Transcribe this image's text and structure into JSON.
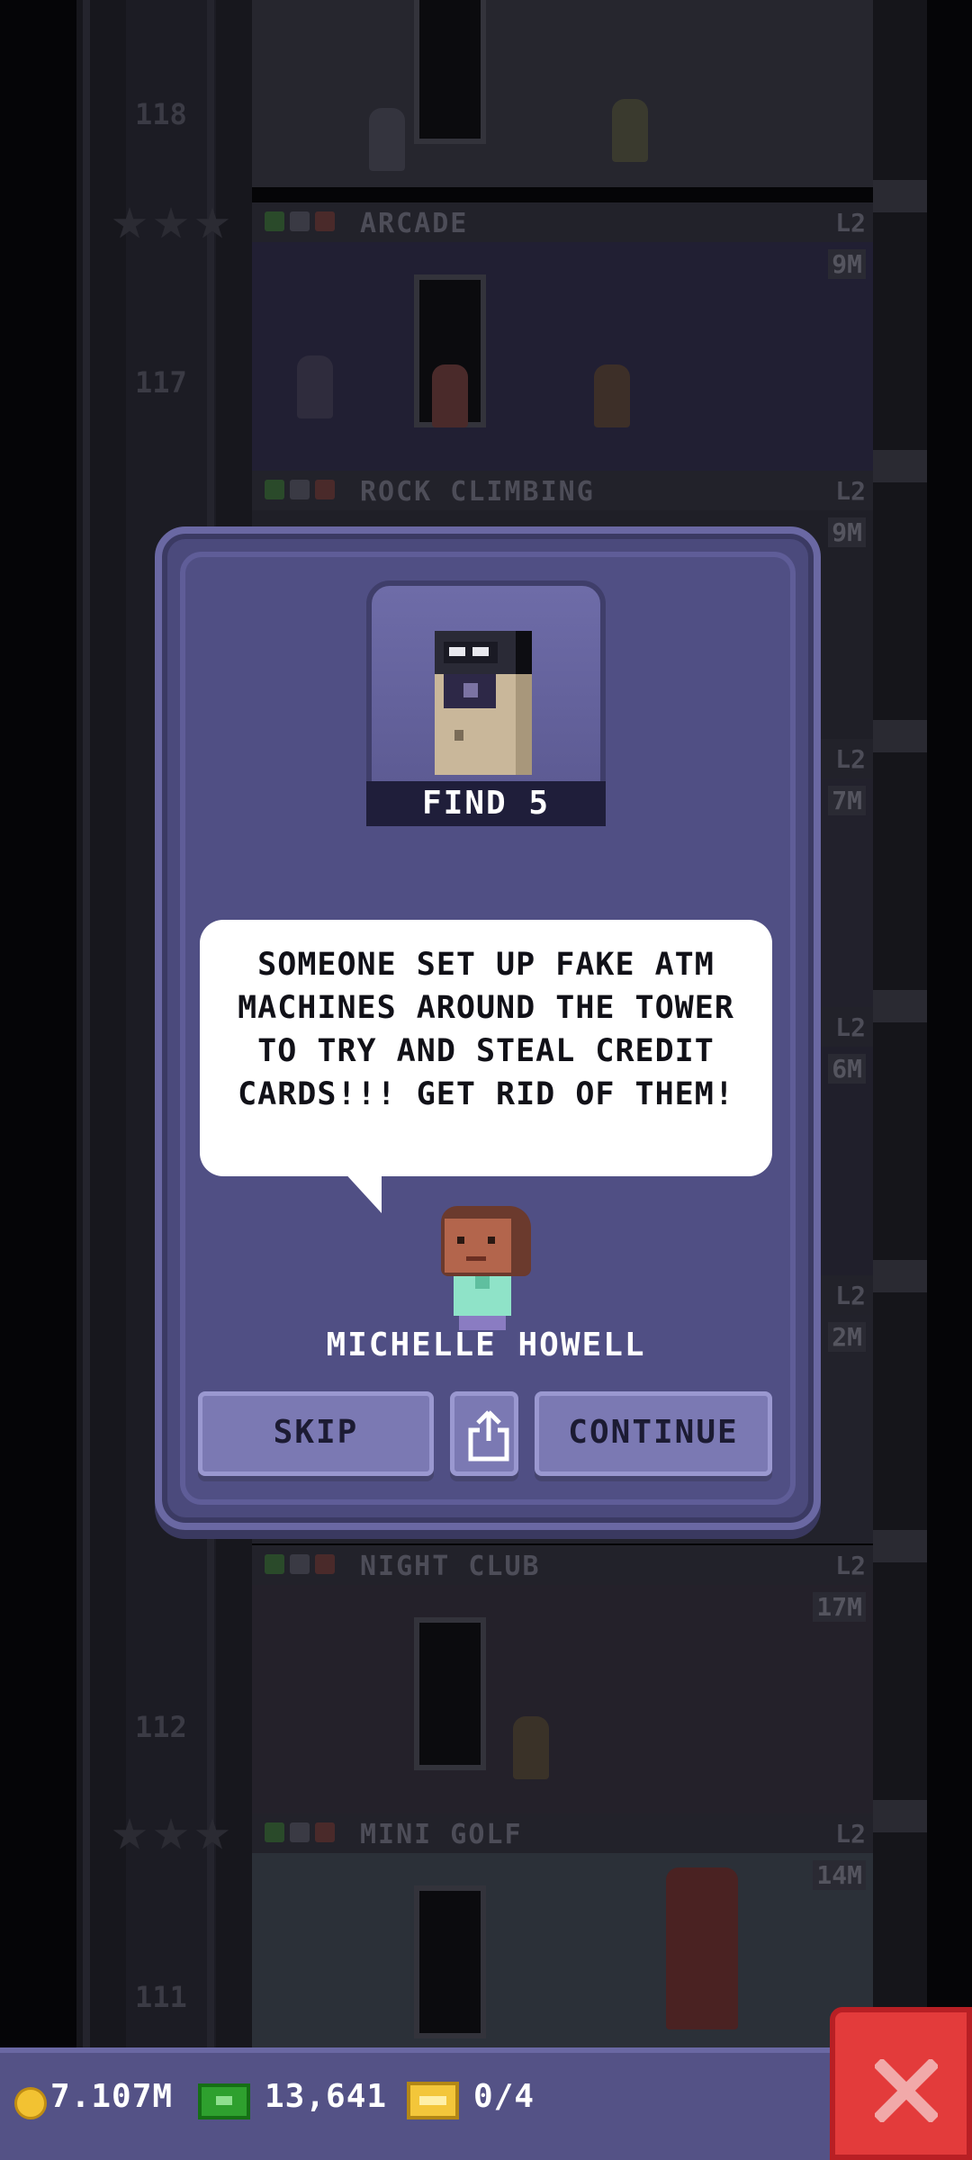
{
  "tower": {
    "floors": [
      {
        "number": "118",
        "name": "",
        "level": "",
        "cost": ""
      },
      {
        "number": "117",
        "name": "ARCADE",
        "level": "L2",
        "cost": "9M"
      },
      {
        "number": "",
        "name": "ROCK CLIMBING",
        "level": "L2",
        "cost": "9M"
      },
      {
        "number": "112",
        "name": "NIGHT CLUB",
        "level": "L2",
        "cost": "17M"
      },
      {
        "number": "111",
        "name": "MINI GOLF",
        "level": "L2",
        "cost": "14M"
      }
    ],
    "partial_costs": [
      "7M",
      "6M",
      "2M"
    ],
    "partial_levels": [
      "L2",
      "L2",
      "L2"
    ]
  },
  "mission": {
    "badge_label": "FIND 5",
    "badge_icon": "atm-machine-icon",
    "message": "SOMEONE SET UP FAKE ATM MACHINES AROUND THE TOWER TO TRY AND STEAL CREDIT CARDS!!! GET RID OF THEM!",
    "character_name": "MICHELLE HOWELL"
  },
  "buttons": {
    "skip": "SKIP",
    "share_icon": "share-icon",
    "continue": "CONTINUE"
  },
  "bottom_bar": {
    "coins": "7.107M",
    "bux": "13,641",
    "tickets": "0/4",
    "close_icon": "close-x-icon"
  },
  "colors": {
    "dialog_bg": "#504f84",
    "button_bg": "#7b79b3",
    "close_red": "#e33b3b",
    "coin_gold": "#f2c232",
    "bux_green": "#2ea02e"
  }
}
